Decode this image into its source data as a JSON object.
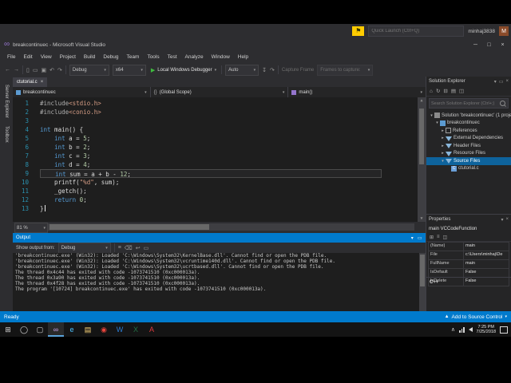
{
  "window": {
    "title": "breakcontinuec - Microsoft Visual Studio",
    "quick_launch": "Quick Launch (Ctrl+Q)",
    "user": "minhaj3838",
    "avatar_initial": "M",
    "minimize": "─",
    "maximize": "□",
    "close": "×"
  },
  "menu": {
    "items": [
      "File",
      "Edit",
      "View",
      "Project",
      "Build",
      "Debug",
      "Team",
      "Tools",
      "Test",
      "Analyze",
      "Window",
      "Help"
    ]
  },
  "toolbar": {
    "config": "Debug",
    "platform": "x64",
    "debugger": "Local Windows Debugger",
    "watch": "Auto",
    "capture": "Capture Frame",
    "frames": "Frames to capture:"
  },
  "side_tabs": {
    "items": [
      "Server Explorer",
      "Toolbox"
    ]
  },
  "editor": {
    "tab": "ctutorial.c",
    "nav": {
      "project": "breakcontinuec",
      "scope": "(Global Scope)",
      "member": "main()"
    },
    "zoom": "81 %",
    "lines": [
      {
        "num": "1",
        "segs": [
          [
            "sp",
            "#include"
          ],
          [
            "ss",
            "<stdio.h>"
          ]
        ]
      },
      {
        "num": "2",
        "segs": [
          [
            "sp",
            "#include"
          ],
          [
            "ss",
            "<conio.h>"
          ]
        ]
      },
      {
        "num": "3",
        "segs": []
      },
      {
        "num": "4",
        "segs": [
          [
            "sk",
            "int"
          ],
          [
            "st",
            " main() {"
          ]
        ]
      },
      {
        "num": "5",
        "segs": [
          [
            "st",
            "    "
          ],
          [
            "sk",
            "int"
          ],
          [
            "st",
            " a = "
          ],
          [
            "sn",
            "5"
          ],
          [
            "st",
            ";"
          ]
        ]
      },
      {
        "num": "6",
        "segs": [
          [
            "st",
            "    "
          ],
          [
            "sk",
            "int"
          ],
          [
            "st",
            " b = "
          ],
          [
            "sn",
            "2"
          ],
          [
            "st",
            ";"
          ]
        ]
      },
      {
        "num": "7",
        "segs": [
          [
            "st",
            "    "
          ],
          [
            "sk",
            "int"
          ],
          [
            "st",
            " c = "
          ],
          [
            "sn",
            "3"
          ],
          [
            "st",
            ";"
          ]
        ]
      },
      {
        "num": "8",
        "segs": [
          [
            "st",
            "    "
          ],
          [
            "sk",
            "int"
          ],
          [
            "st",
            " d = "
          ],
          [
            "sn",
            "4"
          ],
          [
            "st",
            ";"
          ]
        ]
      },
      {
        "num": "9",
        "current": true,
        "segs": [
          [
            "st",
            "    "
          ],
          [
            "sk",
            "int"
          ],
          [
            "st",
            " sum = a + b - "
          ],
          [
            "sn",
            "12"
          ],
          [
            "st",
            ";"
          ]
        ]
      },
      {
        "num": "10",
        "segs": [
          [
            "st",
            "    printf("
          ],
          [
            "ss",
            "\"%d\""
          ],
          [
            "st",
            ", sum);"
          ]
        ]
      },
      {
        "num": "11",
        "segs": [
          [
            "st",
            "    _getch();"
          ]
        ]
      },
      {
        "num": "12",
        "segs": [
          [
            "st",
            "    "
          ],
          [
            "sk",
            "return"
          ],
          [
            "st",
            " "
          ],
          [
            "sn",
            "0"
          ],
          [
            "st",
            ";"
          ]
        ]
      },
      {
        "num": "13",
        "caret": true,
        "segs": [
          [
            "st",
            "}"
          ]
        ]
      }
    ]
  },
  "output": {
    "title": "Output",
    "from_label": "Show output from:",
    "source": "Debug",
    "lines": [
      "'breakcontinuec.exe' (Win32): Loaded 'C:\\Windows\\System32\\KernelBase.dll'. Cannot find or open the PDB file.",
      "'breakcontinuec.exe' (Win32): Loaded 'C:\\Windows\\System32\\vcruntime140d.dll'. Cannot find or open the PDB file.",
      "'breakcontinuec.exe' (Win32): Loaded 'C:\\Windows\\System32\\ucrtbased.dll'. Cannot find or open the PDB file.",
      "The thread 0x4c44 has exited with code -1073741510 (0xc000013a).",
      "The thread 0x3a90 has exited with code -1073741510 (0xc000013a).",
      "The thread 0x4f28 has exited with code -1073741510 (0xc000013a).",
      "The program '[10724] breakcontinuec.exe' has exited with code -1073741510 (0xc000013a)."
    ]
  },
  "solution_explorer": {
    "title": "Solution Explorer",
    "search_placeholder": "Search Solution Explorer (Ctrl+;)",
    "items": [
      {
        "label": "Solution 'breakcontinuec' (1 project)",
        "indent": 0,
        "icon": "solution",
        "arrow": "▾"
      },
      {
        "label": "breakcontinuec",
        "indent": 1,
        "icon": "project",
        "arrow": "▾"
      },
      {
        "label": "References",
        "indent": 2,
        "icon": "refs",
        "arrow": "▸"
      },
      {
        "label": "External Dependencies",
        "indent": 2,
        "icon": "folder",
        "arrow": "▸"
      },
      {
        "label": "Header Files",
        "indent": 2,
        "icon": "folder",
        "arrow": "▸"
      },
      {
        "label": "Resource Files",
        "indent": 2,
        "icon": "folder",
        "arrow": "▸"
      },
      {
        "label": "Source Files",
        "indent": 2,
        "icon": "folder",
        "arrow": "▾",
        "selected": true
      },
      {
        "label": "ctutorial.c",
        "indent": 3,
        "icon": "cfile",
        "arrow": ""
      }
    ]
  },
  "properties": {
    "title": "Properties",
    "object": "main VCCodeFunction",
    "rows": [
      [
        "(Name)",
        "main"
      ],
      [
        "File",
        "c:\\Users\\minhaj\\De"
      ],
      [
        "FullName",
        "main"
      ],
      [
        "IsDefault",
        "False"
      ],
      [
        "IsDelete",
        "False"
      ]
    ],
    "category": "C++"
  },
  "status_bar": {
    "left": "Ready",
    "right": "Add to Source Control"
  },
  "taskbar": {
    "time": "7:25 PM",
    "date": "7/25/2018",
    "apps": [
      {
        "name": "start-button",
        "glyph": "⊞",
        "color": "#d8d8d8"
      },
      {
        "name": "cortana-icon",
        "glyph": "◯",
        "color": "#d8d8d8"
      },
      {
        "name": "task-view-icon",
        "glyph": "▢",
        "color": "#d8d8d8"
      },
      {
        "name": "visual-studio-icon",
        "glyph": "∞",
        "color": "#c9a3e8",
        "active": true
      },
      {
        "name": "edge-icon",
        "glyph": "e",
        "color": "#4cc2ff"
      },
      {
        "name": "file-explorer-icon",
        "glyph": "▤",
        "color": "#ffd77a"
      },
      {
        "name": "chrome-icon",
        "glyph": "◉",
        "color": "#e8453c"
      },
      {
        "name": "word-icon",
        "glyph": "W",
        "color": "#2b7cd3"
      },
      {
        "name": "excel-icon",
        "glyph": "X",
        "color": "#217346"
      },
      {
        "name": "acrobat-icon",
        "glyph": "A",
        "color": "#e03a3e"
      }
    ]
  }
}
